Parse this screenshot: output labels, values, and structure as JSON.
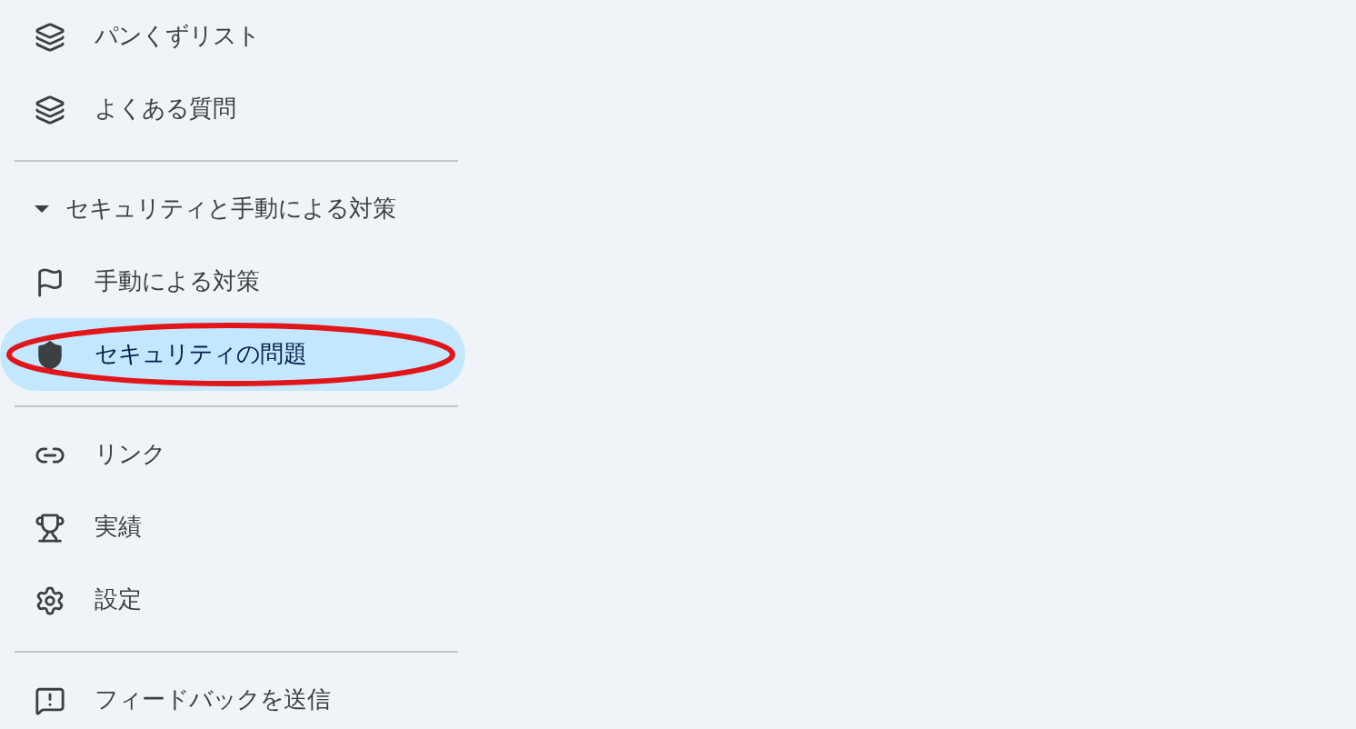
{
  "groups": [
    {
      "items": [
        {
          "label": "パンくずリスト",
          "kind": "layers",
          "selected": false,
          "circled": false
        },
        {
          "label": "よくある質問",
          "kind": "layers",
          "selected": false,
          "circled": false
        }
      ]
    },
    {
      "header": {
        "label": "セキュリティと手動による対策",
        "expanded": true
      },
      "items": [
        {
          "label": "手動による対策",
          "kind": "flag",
          "selected": false,
          "circled": false
        },
        {
          "label": "セキュリティの問題",
          "kind": "shield",
          "selected": true,
          "circled": true
        }
      ]
    },
    {
      "items": [
        {
          "label": "リンク",
          "kind": "link",
          "selected": false,
          "circled": false
        },
        {
          "label": "実績",
          "kind": "trophy",
          "selected": false,
          "circled": false
        },
        {
          "label": "設定",
          "kind": "gear",
          "selected": false,
          "circled": false
        }
      ]
    },
    {
      "items": [
        {
          "label": "フィードバックを送信",
          "kind": "feedback",
          "selected": false,
          "circled": false
        }
      ]
    }
  ]
}
